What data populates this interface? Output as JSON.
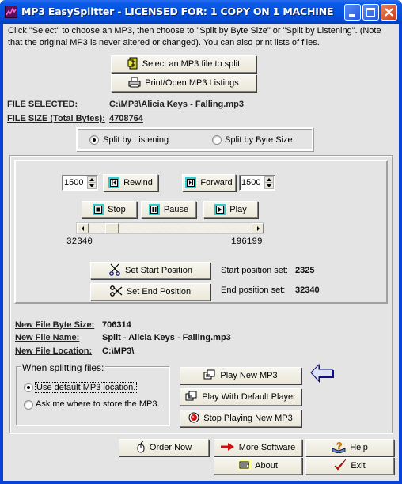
{
  "window": {
    "title": "MP3 EasySplitter - LICENSED FOR: 1 COPY ON 1 MACHINE",
    "controls": {
      "minimize": "minimize",
      "maximize": "maximize",
      "close": "close"
    }
  },
  "intro_text": "Click \"Select\" to choose an MP3, then choose to \"Split by Byte Size\" or \"Split by Listening\". (Note that the original MP3 is never altered or changed). You can also print lists of files.",
  "file_buttons": {
    "select": {
      "label": "Select an MP3 file to split",
      "icon": "file-cabinet-icon"
    },
    "print": {
      "label": "Print/Open MP3 Listings",
      "icon": "printer-icon"
    }
  },
  "file_info": {
    "selected_label": "FILE SELECTED:",
    "selected_value": "C:\\MP3\\Alicia Keys - Falling.mp3",
    "size_label": "FILE SIZE (Total Bytes):",
    "size_value": "4708764"
  },
  "split_mode": {
    "options": [
      {
        "label": "Split by Listening",
        "selected": true
      },
      {
        "label": "Split by Byte Size",
        "selected": false
      }
    ]
  },
  "player": {
    "rewind_step": "1500",
    "forward_step": "1500",
    "rewind_label": "Rewind",
    "forward_label": "Forward",
    "stop_label": "Stop",
    "pause_label": "Pause",
    "play_label": "Play",
    "position_min_label": "32340",
    "position_max_label": "196199",
    "scroll_position_fraction": 0.11
  },
  "positions": {
    "set_start_label": "Set Start Position",
    "set_end_label": "Set End Position",
    "start_set_label": "Start position set:",
    "start_set_value": "2325",
    "end_set_label": "End position set:",
    "end_set_value": "32340"
  },
  "new_file": {
    "byte_size_label": "New File Byte Size:",
    "byte_size_value": "706314",
    "name_label": "New File Name:",
    "name_value": "Split - Alicia Keys - Falling.mp3",
    "location_label": "New File Location:",
    "location_value": "C:\\MP3\\"
  },
  "splitting_options": {
    "title": "When splitting files:",
    "options": [
      {
        "label": "Use default MP3 location.",
        "selected": true
      },
      {
        "label": "Ask me where to store the MP3.",
        "selected": false
      }
    ]
  },
  "playback_buttons": {
    "play_new": "Play New MP3",
    "play_default": "Play With Default Player",
    "stop_playing": "Stop Playing New MP3"
  },
  "footer_buttons": {
    "order": "Order Now",
    "more_software": "More Software",
    "help": "Help",
    "about": "About",
    "exit": "Exit"
  },
  "colors": {
    "title_bar": "#0352e0",
    "client_bg": "#e4e4e4",
    "media_icon_accent": "#37c9c9",
    "arrow_blue": "#101080"
  }
}
